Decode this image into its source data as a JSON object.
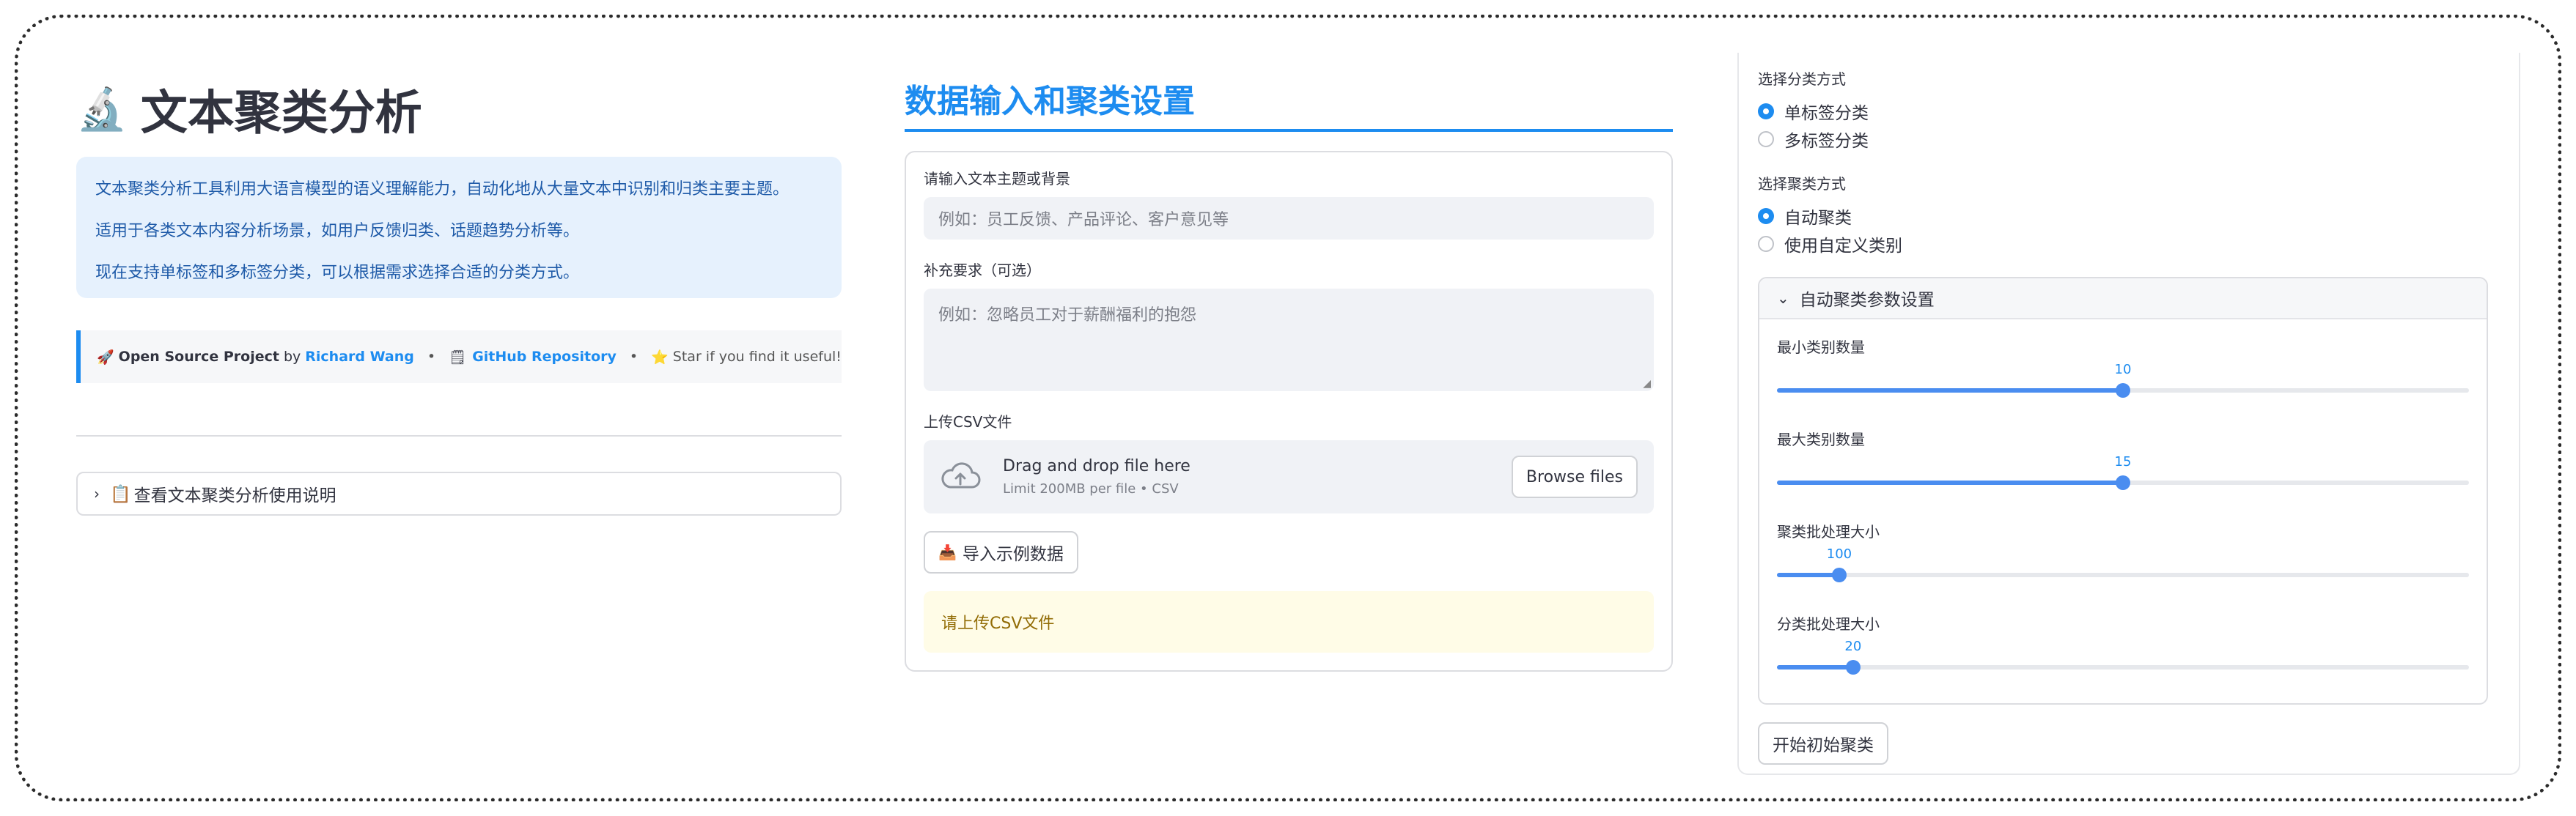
{
  "left": {
    "title": "文本聚类分析",
    "title_icon": "microscope-icon",
    "intro": [
      "文本聚类分析工具利用大语言模型的语义理解能力，自动化地从大量文本中识别和归类主要主题。",
      "适用于各类文本内容分析场景，如用户反馈归类、话题趋势分析等。",
      "现在支持单标签和多标签分类，可以根据需求选择合适的分类方式。"
    ],
    "oss": {
      "rocket": "🚀",
      "project_label": "Open Source Project",
      "by": "by",
      "author": "Richard Wang",
      "sep": "•",
      "github_icon": "🗒",
      "github_label": "GitHub Repository",
      "star_icon": "⭐",
      "star_text": "Star if you find it useful!"
    },
    "guide_expander": {
      "icon": "📋",
      "label": "查看文本聚类分析使用说明"
    }
  },
  "middle": {
    "section_title": "数据输入和聚类设置",
    "topic_label": "请输入文本主题或背景",
    "topic_placeholder": "例如：员工反馈、产品评论、客户意见等",
    "extra_label": "补充要求（可选）",
    "extra_placeholder": "例如：忽略员工对于薪酬福利的抱怨",
    "upload_label": "上传CSV文件",
    "upload_main": "Drag and drop file here",
    "upload_sub": "Limit 200MB per file • CSV",
    "browse_label": "Browse files",
    "sample_button_icon": "📥",
    "sample_button_label": "导入示例数据",
    "warning_text": "请上传CSV文件"
  },
  "right": {
    "classify_mode_label": "选择分类方式",
    "classify_options": [
      "单标签分类",
      "多标签分类"
    ],
    "classify_selected": 0,
    "cluster_mode_label": "选择聚类方式",
    "cluster_options": [
      "自动聚类",
      "使用自定义类别"
    ],
    "cluster_selected": 0,
    "params_title": "自动聚类参数设置",
    "sliders": [
      {
        "label": "最小类别数量",
        "value": "10",
        "fraction": 0.5
      },
      {
        "label": "最大类别数量",
        "value": "15",
        "fraction": 0.5
      },
      {
        "label": "聚类批处理大小",
        "value": "100",
        "fraction": 0.09
      },
      {
        "label": "分类批处理大小",
        "value": "20",
        "fraction": 0.11
      }
    ],
    "start_button_label": "开始初始聚类"
  },
  "colors": {
    "accent": "#1d8cf0",
    "slider": "#4a8df0",
    "info_bg": "#e6f1fd",
    "warn_bg": "#fffce7",
    "warn_text": "#926c05"
  }
}
